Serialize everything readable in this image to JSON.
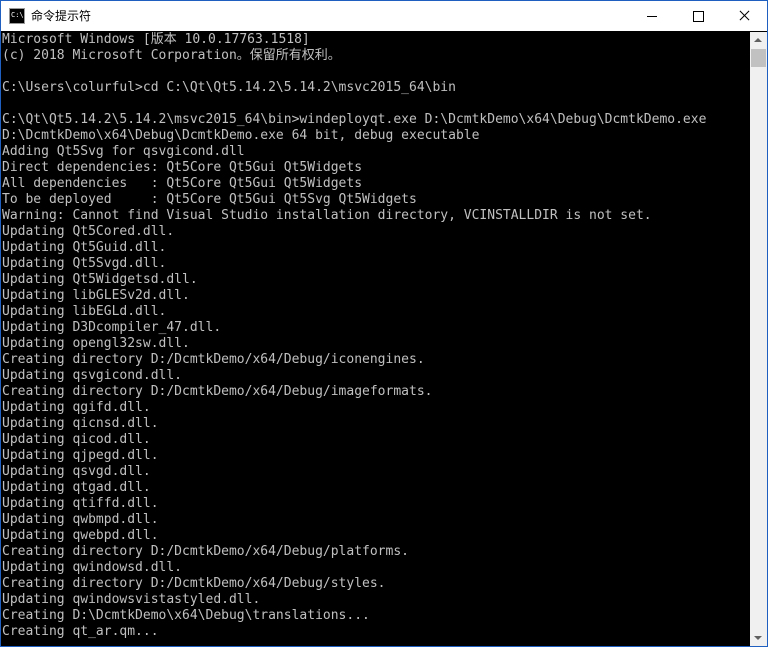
{
  "window": {
    "title": "命令提示符",
    "icon": "cmd-icon"
  },
  "controls": {
    "minimize": "minimize-icon",
    "maximize": "maximize-icon",
    "close": "close-icon"
  },
  "console": {
    "lines": [
      "Microsoft Windows [版本 10.0.17763.1518]",
      "(c) 2018 Microsoft Corporation。保留所有权利。",
      "",
      "C:\\Users\\colurful>cd C:\\Qt\\Qt5.14.2\\5.14.2\\msvc2015_64\\bin",
      "",
      "C:\\Qt\\Qt5.14.2\\5.14.2\\msvc2015_64\\bin>windeployqt.exe D:\\DcmtkDemo\\x64\\Debug\\DcmtkDemo.exe",
      "D:\\DcmtkDemo\\x64\\Debug\\DcmtkDemo.exe 64 bit, debug executable",
      "Adding Qt5Svg for qsvgicond.dll",
      "Direct dependencies: Qt5Core Qt5Gui Qt5Widgets",
      "All dependencies   : Qt5Core Qt5Gui Qt5Widgets",
      "To be deployed     : Qt5Core Qt5Gui Qt5Svg Qt5Widgets",
      "Warning: Cannot find Visual Studio installation directory, VCINSTALLDIR is not set.",
      "Updating Qt5Cored.dll.",
      "Updating Qt5Guid.dll.",
      "Updating Qt5Svgd.dll.",
      "Updating Qt5Widgetsd.dll.",
      "Updating libGLESv2d.dll.",
      "Updating libEGLd.dll.",
      "Updating D3Dcompiler_47.dll.",
      "Updating opengl32sw.dll.",
      "Creating directory D:/DcmtkDemo/x64/Debug/iconengines.",
      "Updating qsvgicond.dll.",
      "Creating directory D:/DcmtkDemo/x64/Debug/imageformats.",
      "Updating qgifd.dll.",
      "Updating qicnsd.dll.",
      "Updating qicod.dll.",
      "Updating qjpegd.dll.",
      "Updating qsvgd.dll.",
      "Updating qtgad.dll.",
      "Updating qtiffd.dll.",
      "Updating qwbmpd.dll.",
      "Updating qwebpd.dll.",
      "Creating directory D:/DcmtkDemo/x64/Debug/platforms.",
      "Updating qwindowsd.dll.",
      "Creating directory D:/DcmtkDemo/x64/Debug/styles.",
      "Updating qwindowsvistastyled.dll.",
      "Creating D:\\DcmtkDemo\\x64\\Debug\\translations...",
      "Creating qt_ar.qm..."
    ]
  },
  "colors": {
    "console_bg": "#000000",
    "console_text": "#c0c0c0",
    "titlebar_bg": "#ffffff",
    "window_border": "#1f5fbf"
  }
}
